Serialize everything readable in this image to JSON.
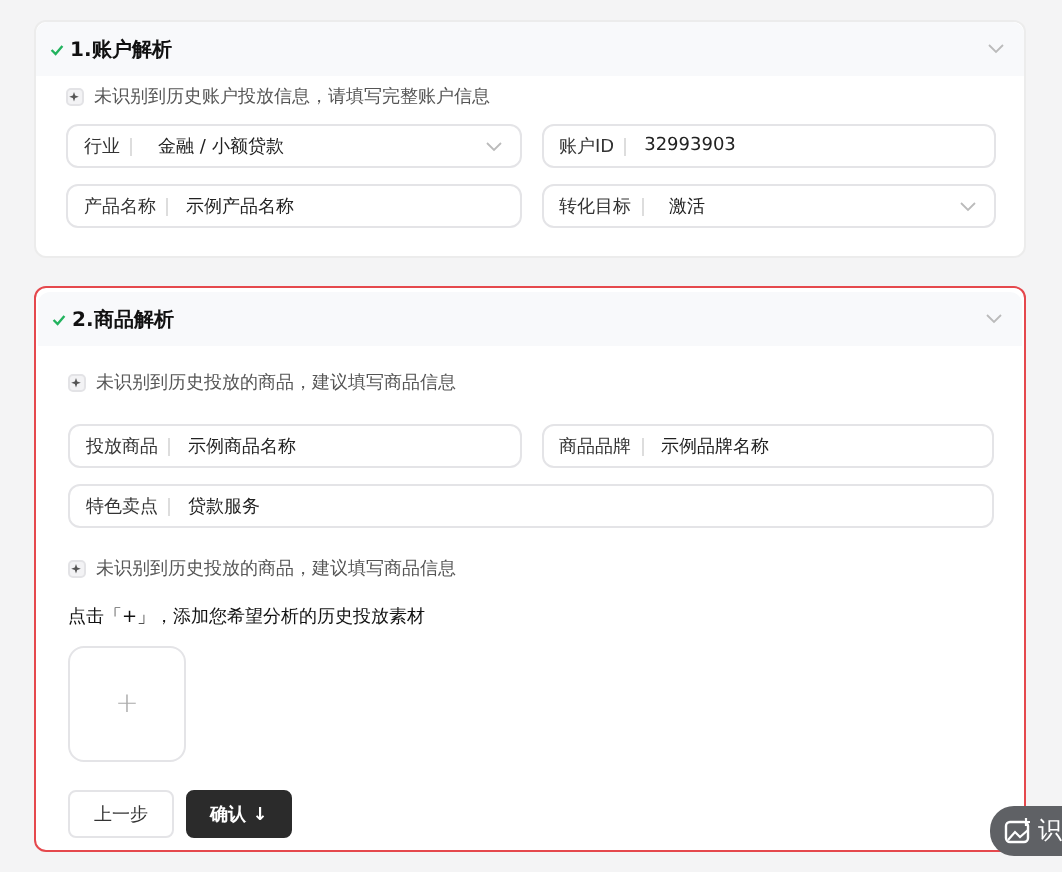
{
  "sections": [
    {
      "title": "1.账户解析",
      "completed": true,
      "highlighted": false,
      "expanded": true,
      "hints": [
        "未识别到历史账户投放信息，请填写完整账户信息"
      ],
      "fields": [
        {
          "kind": "select",
          "label": "行业",
          "value": "金融 / 小额贷款",
          "full": false
        },
        {
          "kind": "text",
          "label": "账户ID",
          "value": "32993903",
          "full": false
        },
        {
          "kind": "text",
          "label": "产品名称",
          "value": "示例产品名称",
          "full": false
        },
        {
          "kind": "select",
          "label": "转化目标",
          "value": "激活",
          "full": false
        }
      ]
    },
    {
      "title": "2.商品解析",
      "completed": true,
      "highlighted": true,
      "expanded": true,
      "hints": [
        "未识别到历史投放的商品，建议填写商品信息"
      ],
      "fields": [
        {
          "kind": "text",
          "label": "投放商品",
          "value": "示例商品名称",
          "full": false
        },
        {
          "kind": "text",
          "label": "商品品牌",
          "value": "示例品牌名称",
          "full": false
        },
        {
          "kind": "text",
          "label": "特色卖点",
          "value": "贷款服务",
          "full": true
        }
      ],
      "hint2": "未识别到历史投放的商品，建议填写商品信息",
      "upload_prompt": "点击「+」，添加您希望分析的历史投放素材",
      "upload_symbol": "+",
      "buttons": [
        {
          "kind": "secondary",
          "label": "上一步"
        },
        {
          "kind": "primary",
          "label": "确认 ↓"
        }
      ]
    }
  ],
  "floating_button": {
    "label": "识"
  }
}
